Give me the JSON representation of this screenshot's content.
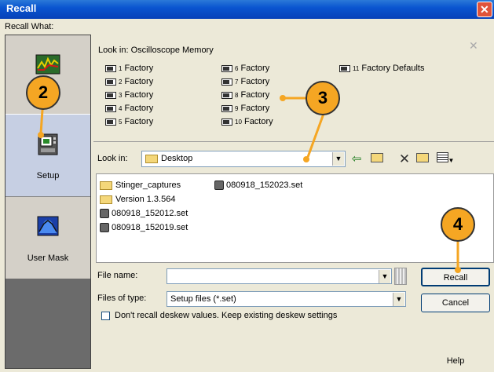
{
  "window": {
    "title": "Recall"
  },
  "recall_what_label": "Recall What:",
  "sidebar": {
    "items": [
      {
        "label": "Waveform",
        "visible_label": "form",
        "icon": "waveform-icon"
      },
      {
        "label": "Setup",
        "icon": "setup-icon",
        "selected": true
      },
      {
        "label": "User Mask",
        "icon": "user-mask-icon"
      }
    ]
  },
  "memory": {
    "title": "Look in: Oscilloscope Memory",
    "items": [
      {
        "num": "1",
        "label": "Factory"
      },
      {
        "num": "2",
        "label": "Factory"
      },
      {
        "num": "3",
        "label": "Factory"
      },
      {
        "num": "4",
        "label": "Factory"
      },
      {
        "num": "5",
        "label": "Factory"
      },
      {
        "num": "6",
        "label": "Factory"
      },
      {
        "num": "7",
        "label": "Factory"
      },
      {
        "num": "8",
        "label": "Factory"
      },
      {
        "num": "9",
        "label": "Factory"
      },
      {
        "num": "10",
        "label": "Factory"
      },
      {
        "num": "11",
        "label": "Factory Defaults"
      }
    ]
  },
  "file_dialog": {
    "look_in_label": "Look in:",
    "look_in_value": "Desktop",
    "files": [
      {
        "name": "Stinger_captures",
        "type": "folder"
      },
      {
        "name": "Version 1.3.564",
        "type": "folder"
      },
      {
        "name": "080918_152012.set",
        "type": "file"
      },
      {
        "name": "080918_152019.set",
        "type": "file"
      },
      {
        "name": "080918_152023.set",
        "type": "file"
      }
    ],
    "file_name_label": "File name:",
    "file_name_value": "",
    "files_of_type_label": "Files of type:",
    "files_of_type_value": "Setup files (*.set)",
    "deskew_checkbox_label": "Don't recall deskew values. Keep existing deskew settings",
    "recall_button": "Recall",
    "cancel_button": "Cancel",
    "help_button": "Help"
  },
  "callouts": [
    "2",
    "3",
    "4"
  ],
  "colors": {
    "callout": "#f5a623",
    "titlebar": "#0a55d0",
    "sidebar_selected": "#c6cfe3"
  }
}
